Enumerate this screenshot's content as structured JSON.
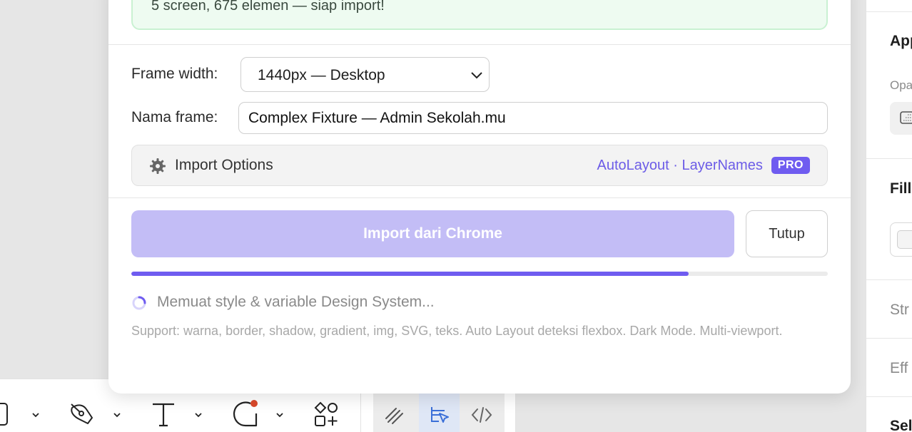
{
  "modal": {
    "success_message": "5 screen, 675 elemen — siap import!",
    "frame_width_label": "Frame width:",
    "frame_width_value": "1440px — Desktop",
    "frame_name_label": "Nama frame:",
    "frame_name_value": "Complex Fixture — Admin Sekolah.mu",
    "import_options_label": "Import Options",
    "import_options_features": "AutoLayout · LayerNames",
    "pro_badge": "PRO",
    "import_button": "Import dari Chrome",
    "close_button": "Tutup",
    "progress_fraction": 0.8,
    "loading_status": "Memuat style & variable Design System...",
    "support_note": "Support: warna, border, shadow, gradient, img, SVG, teks. Auto Layout deteksi flexbox. Dark Mode. Multi-viewport."
  },
  "right_panel": {
    "appearance_title": "App",
    "opacity_label": "Opa",
    "fill_title": "Fill",
    "stroke_title": "Str",
    "effects_title": "Eff",
    "selection_title": "Sel"
  },
  "toolbar": {
    "tools": [
      "frame-tool",
      "pen-tool",
      "text-tool",
      "shape-tool",
      "components-tool",
      "draw-tool",
      "design-mode-tool",
      "dev-mode-tool"
    ]
  },
  "colors": {
    "accent": "#6f5cf0",
    "accent_disabled": "#c3bdf6",
    "success_bg": "#eefbf1",
    "success_border": "#c9f1d2",
    "notification_dot": "#d9482b"
  }
}
